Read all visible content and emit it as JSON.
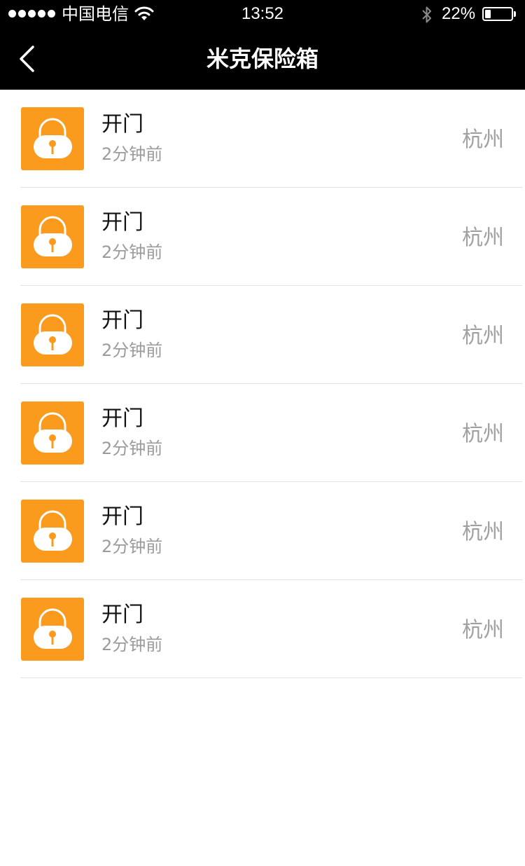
{
  "status_bar": {
    "carrier": "中国电信",
    "time": "13:52",
    "battery_percent": "22%",
    "battery_level": 0.22,
    "signal_bars": 5,
    "icons": [
      "signal-dots-icon",
      "wifi-icon",
      "bluetooth-icon",
      "battery-icon"
    ]
  },
  "nav": {
    "title": "米克保险箱",
    "back_icon": "chevron-left-icon"
  },
  "colors": {
    "accent": "#fa9b1e",
    "bar_background": "#000000",
    "title_text": "#111111",
    "secondary_text": "#9b9b9b"
  },
  "records": [
    {
      "icon": "lock-icon",
      "title": "开门",
      "time": "2分钟前",
      "location": "杭州"
    },
    {
      "icon": "lock-icon",
      "title": "开门",
      "time": "2分钟前",
      "location": "杭州"
    },
    {
      "icon": "lock-icon",
      "title": "开门",
      "time": "2分钟前",
      "location": "杭州"
    },
    {
      "icon": "lock-icon",
      "title": "开门",
      "time": "2分钟前",
      "location": "杭州"
    },
    {
      "icon": "lock-icon",
      "title": "开门",
      "time": "2分钟前",
      "location": "杭州"
    },
    {
      "icon": "lock-icon",
      "title": "开门",
      "time": "2分钟前",
      "location": "杭州"
    }
  ]
}
